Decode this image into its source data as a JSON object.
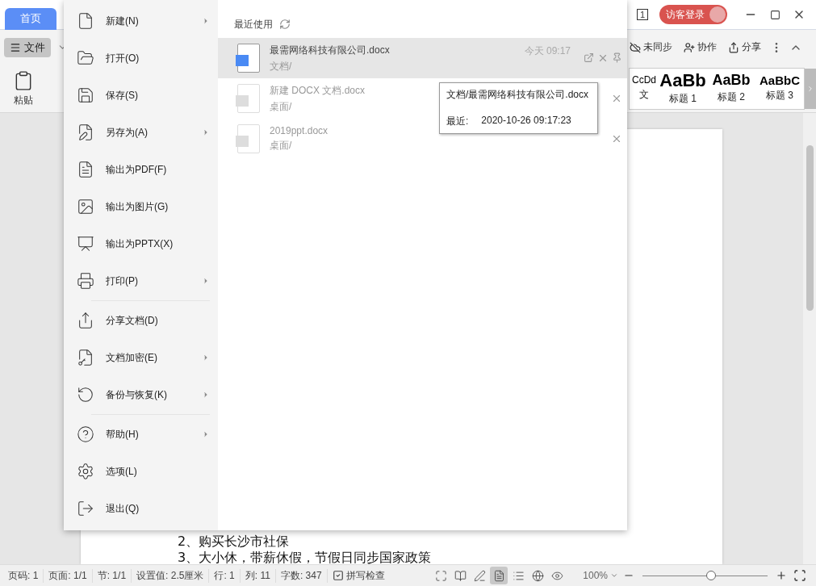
{
  "title_bar": {
    "tab": {
      "label": "首页",
      "selected": true
    },
    "doc_count": "1",
    "login": "访客登录"
  },
  "toolbar": {
    "file_button": "文件",
    "actions": [
      {
        "kind": "sync",
        "label": "未同步"
      },
      {
        "kind": "collab",
        "label": "协作"
      },
      {
        "kind": "share",
        "label": "分享"
      }
    ]
  },
  "ribbon": {
    "paste": "粘贴",
    "styles": [
      {
        "kind": "body",
        "sample": "CcDd",
        "name": "文"
      },
      {
        "kind": "h1",
        "sample": "AaBb",
        "name": "标题 1"
      },
      {
        "kind": "h2",
        "sample": "AaBb",
        "name": "标题 2"
      },
      {
        "kind": "h3",
        "sample": "AaBbC",
        "name": "标题 3"
      }
    ]
  },
  "document": {
    "lines": [
      "2、购买长沙市社保",
      "3、大小休，带薪休假，节假日同步国家政策"
    ]
  },
  "file_menu": {
    "groups": [
      {
        "items": [
          {
            "kind": "new",
            "label": "新建(N)",
            "submenu": true
          },
          {
            "kind": "open",
            "label": "打开(O)",
            "submenu": false
          },
          {
            "kind": "save",
            "label": "保存(S)",
            "submenu": false
          },
          {
            "kind": "saveas",
            "label": "另存为(A)",
            "submenu": true
          },
          {
            "kind": "pdf",
            "label": "输出为PDF(F)",
            "submenu": false
          },
          {
            "kind": "image",
            "label": "输出为图片(G)",
            "submenu": false
          },
          {
            "kind": "pptx",
            "label": "输出为PPTX(X)",
            "submenu": false
          },
          {
            "kind": "print",
            "label": "打印(P)",
            "submenu": true
          }
        ]
      },
      {
        "items": [
          {
            "kind": "share",
            "label": "分享文档(D)",
            "submenu": false
          },
          {
            "kind": "encrypt",
            "label": "文档加密(E)",
            "submenu": true
          },
          {
            "kind": "backup",
            "label": "备份与恢复(K)",
            "submenu": true
          }
        ]
      },
      {
        "items": [
          {
            "kind": "help",
            "label": "帮助(H)",
            "submenu": true
          },
          {
            "kind": "options",
            "label": "选项(L)",
            "submenu": false
          },
          {
            "kind": "exit",
            "label": "退出(Q)",
            "submenu": false
          }
        ]
      }
    ]
  },
  "recent": {
    "title": "最近使用",
    "files": [
      {
        "name": "最需网络科技有限公司.docx",
        "folder": "文档/",
        "time": "今天 09:17",
        "selected": true
      },
      {
        "name": "新建 DOCX 文档.docx",
        "folder": "桌面/",
        "selected": false
      },
      {
        "name": "2019ppt.docx",
        "folder": "桌面/",
        "selected": false
      }
    ],
    "tooltip": {
      "path": "文档/最需网络科技有限公司.docx",
      "label": "最近:",
      "time": "2020-10-26 09:17:23"
    }
  },
  "status_bar": {
    "items": [
      "页码: 1",
      "页面: 1/1",
      "节: 1/1",
      "设置值: 2.5厘米",
      "行: 1",
      "列: 11",
      "字数: 347"
    ],
    "spell": "拼写检查",
    "views": [
      {
        "kind": "fullscreen",
        "selected": false
      },
      {
        "kind": "read",
        "selected": false
      },
      {
        "kind": "edit",
        "selected": false
      },
      {
        "kind": "page",
        "selected": true
      },
      {
        "kind": "outline",
        "selected": false
      },
      {
        "kind": "web",
        "selected": false
      },
      {
        "kind": "eye",
        "selected": false
      }
    ],
    "zoom": "100%",
    "zoom_slider": {
      "level": 0.55
    }
  }
}
